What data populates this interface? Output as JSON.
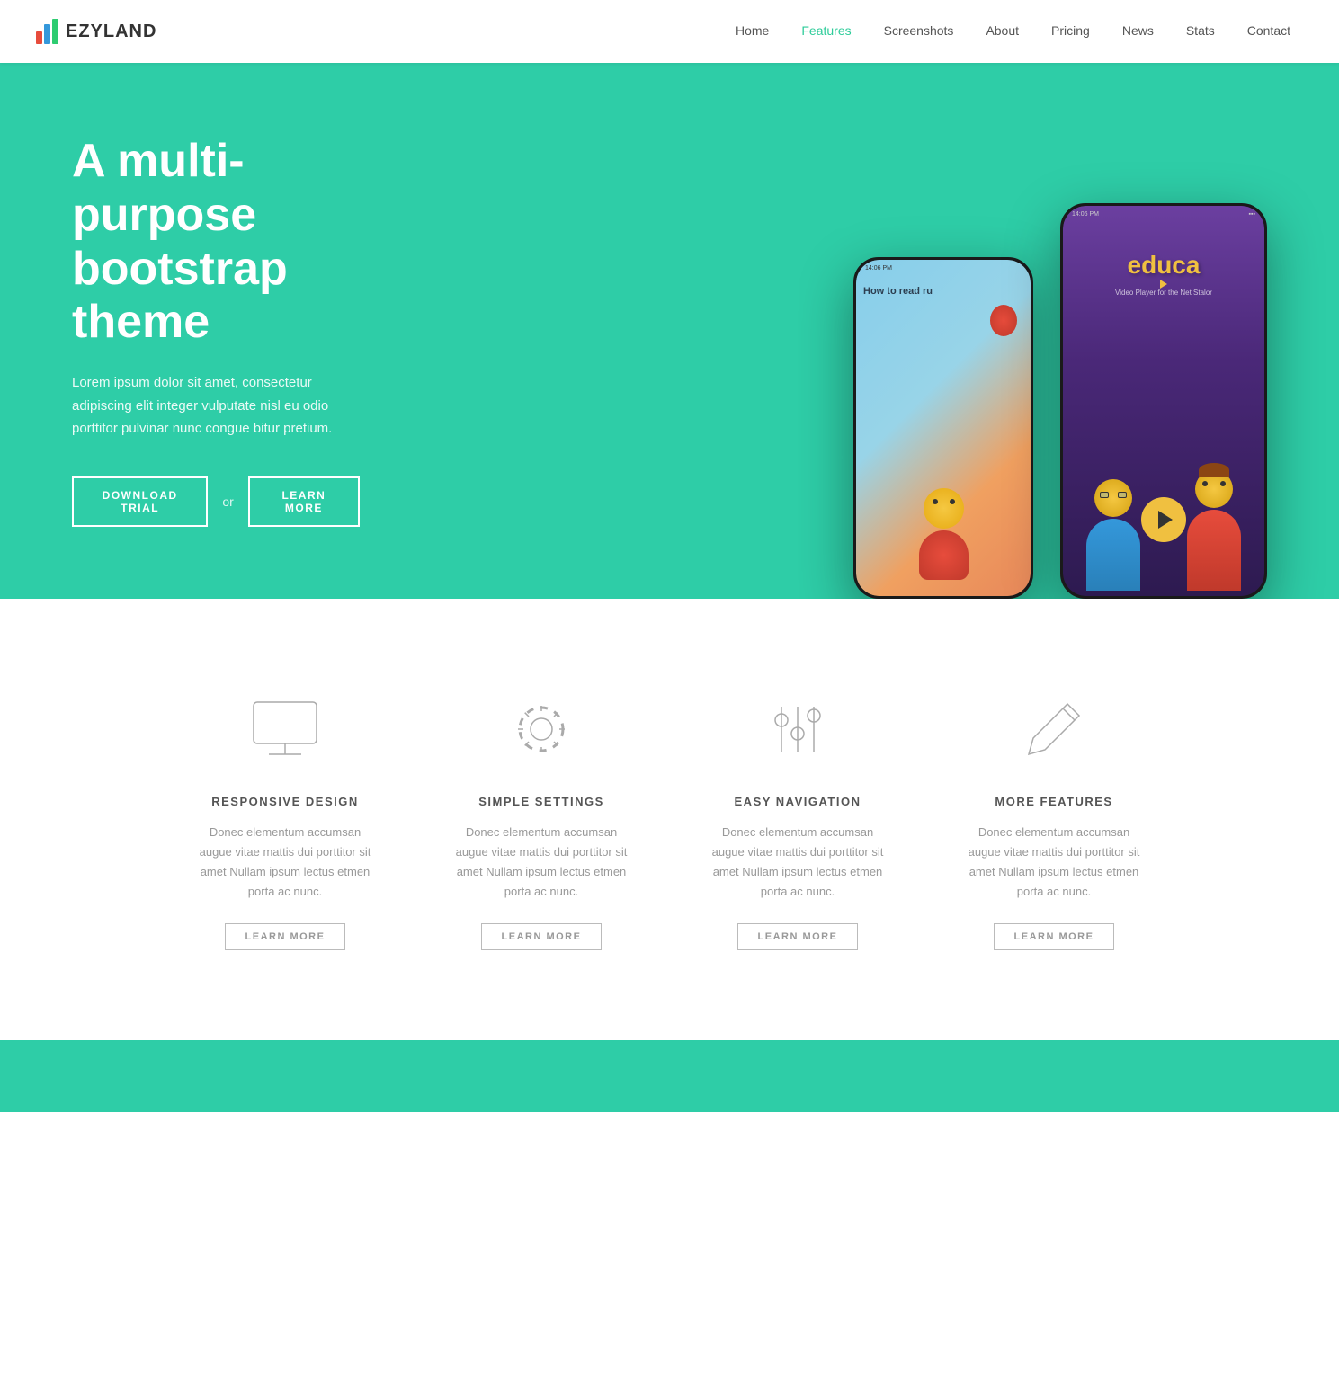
{
  "brand": {
    "name": "EZYLAND",
    "logo_alt": "Ezyland logo"
  },
  "nav": {
    "items": [
      {
        "label": "Home",
        "active": false
      },
      {
        "label": "Features",
        "active": true
      },
      {
        "label": "Screenshots",
        "active": false
      },
      {
        "label": "About",
        "active": false
      },
      {
        "label": "Pricing",
        "active": false
      },
      {
        "label": "News",
        "active": false
      },
      {
        "label": "Stats",
        "active": false
      },
      {
        "label": "Contact",
        "active": false
      }
    ]
  },
  "hero": {
    "title": "A multi-purpose bootstrap theme",
    "description": "Lorem ipsum dolor sit amet, consectetur adipiscing elit integer vulputate nisl eu odio porttitor pulvinar nunc congue bitur pretium.",
    "btn_download": "DOWNLOAD TRIAL",
    "btn_or": "or",
    "btn_learn": "LEARN MORE"
  },
  "features": {
    "items": [
      {
        "icon": "monitor",
        "title": "RESPONSIVE DESIGN",
        "text": "Donec elementum accumsan augue vitae mattis dui porttitor sit amet Nullam ipsum lectus etmen porta ac nunc.",
        "btn": "LEARN MORE"
      },
      {
        "icon": "settings",
        "title": "SIMPLE SETTINGS",
        "text": "Donec elementum accumsan augue vitae mattis dui porttitor sit amet Nullam ipsum lectus etmen porta ac nunc.",
        "btn": "LEARN MORE"
      },
      {
        "icon": "sliders",
        "title": "EASY NAVIGATION",
        "text": "Donec elementum accumsan augue vitae mattis dui porttitor sit amet Nullam ipsum lectus etmen porta ac nunc.",
        "btn": "LEARN MORE"
      },
      {
        "icon": "pencil",
        "title": "MORE FEATURES",
        "text": "Donec elementum accumsan augue vitae mattis dui porttitor sit amet Nullam ipsum lectus etmen porta ac nunc.",
        "btn": "LEARN MORE"
      }
    ]
  },
  "phone_left": {
    "time": "14:06 PM",
    "app_title": "How to read ru"
  },
  "phone_right": {
    "time": "14:06 PM",
    "app_name": "educa",
    "app_sub": "Video Player for the Net Stalor"
  }
}
